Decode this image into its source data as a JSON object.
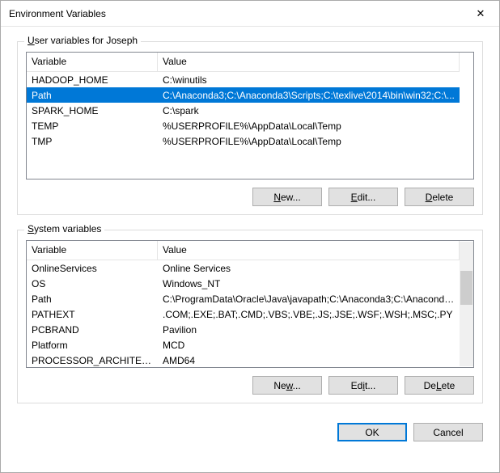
{
  "window": {
    "title": "Environment Variables"
  },
  "user_group": {
    "legend_pre": "U",
    "legend_rest": "ser variables for Joseph",
    "headers": {
      "variable": "Variable",
      "value": "Value"
    },
    "rows": [
      {
        "name": "HADOOP_HOME",
        "value": "C:\\winutils",
        "selected": false
      },
      {
        "name": "Path",
        "value": "C:\\Anaconda3;C:\\Anaconda3\\Scripts;C:\\texlive\\2014\\bin\\win32;C:\\...",
        "selected": true
      },
      {
        "name": "SPARK_HOME",
        "value": "C:\\spark",
        "selected": false
      },
      {
        "name": "TEMP",
        "value": "%USERPROFILE%\\AppData\\Local\\Temp",
        "selected": false
      },
      {
        "name": "TMP",
        "value": "%USERPROFILE%\\AppData\\Local\\Temp",
        "selected": false
      }
    ],
    "buttons": {
      "new_u": "N",
      "new_rest": "ew...",
      "edit_u": "E",
      "edit_rest": "dit...",
      "delete_u": "D",
      "delete_rest": "elete"
    }
  },
  "system_group": {
    "legend_pre": "S",
    "legend_rest": "ystem variables",
    "headers": {
      "variable": "Variable",
      "value": "Value"
    },
    "rows": [
      {
        "name": "OnlineServices",
        "value": "Online Services"
      },
      {
        "name": "OS",
        "value": "Windows_NT"
      },
      {
        "name": "Path",
        "value": "C:\\ProgramData\\Oracle\\Java\\javapath;C:\\Anaconda3;C:\\Anaconda..."
      },
      {
        "name": "PATHEXT",
        "value": ".COM;.EXE;.BAT;.CMD;.VBS;.VBE;.JS;.JSE;.WSF;.WSH;.MSC;.PY"
      },
      {
        "name": "PCBRAND",
        "value": "Pavilion"
      },
      {
        "name": "Platform",
        "value": "MCD"
      },
      {
        "name": "PROCESSOR_ARCHITECTURE",
        "value": "AMD64"
      }
    ],
    "buttons": {
      "new_u": "w",
      "new_pre": "Ne",
      "new_post": "...",
      "edit_u": "i",
      "edit_pre": "Ed",
      "edit_post": "t...",
      "delete_u": "L",
      "delete_pre": "De",
      "delete_post": "ete"
    }
  },
  "bottom": {
    "ok": "OK",
    "cancel": "Cancel"
  }
}
